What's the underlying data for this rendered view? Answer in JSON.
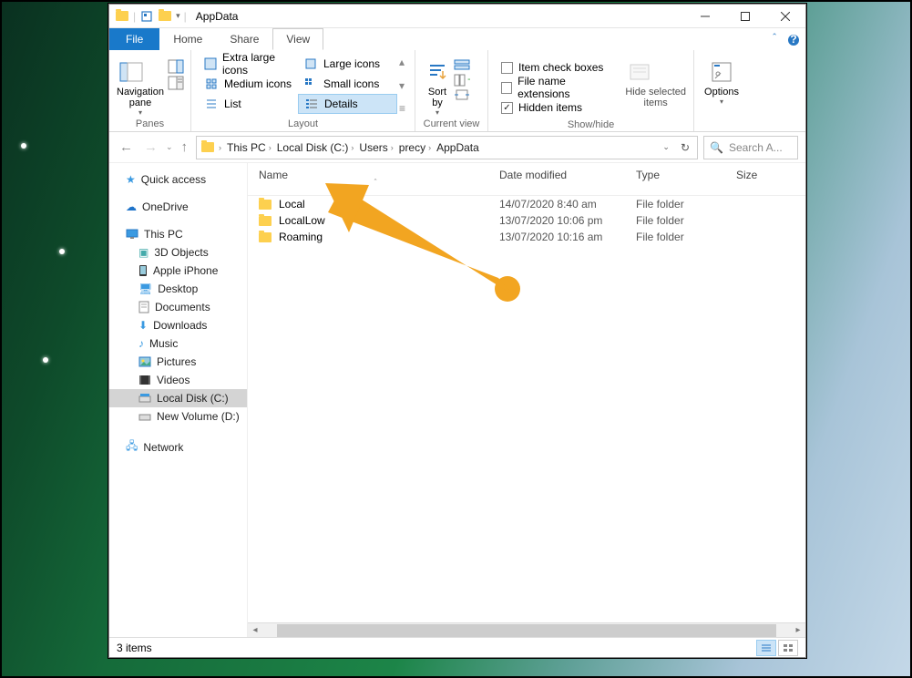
{
  "window": {
    "title": "AppData",
    "min_tooltip": "Minimize",
    "max_tooltip": "Maximize",
    "close_tooltip": "Close"
  },
  "tabs": {
    "file": "File",
    "home": "Home",
    "share": "Share",
    "view": "View"
  },
  "ribbon": {
    "panes_group": "Panes",
    "navigation_pane": "Navigation\npane",
    "layout_group": "Layout",
    "extra_large": "Extra large icons",
    "large": "Large icons",
    "medium": "Medium icons",
    "small": "Small icons",
    "list": "List",
    "details": "Details",
    "current_view_group": "Current view",
    "sort_by": "Sort\nby",
    "show_hide_group": "Show/hide",
    "item_check": "Item check boxes",
    "file_ext": "File name extensions",
    "hidden": "Hidden items",
    "hide_selected": "Hide selected\nitems",
    "options": "Options"
  },
  "breadcrumb": {
    "items": [
      "This PC",
      "Local Disk (C:)",
      "Users",
      "precy",
      "AppData"
    ]
  },
  "search": {
    "placeholder": "Search A..."
  },
  "refresh": "Refresh",
  "nav": {
    "quick": "Quick access",
    "onedrive": "OneDrive",
    "thispc": "This PC",
    "obj3d": "3D Objects",
    "iphone": "Apple iPhone",
    "desktop": "Desktop",
    "documents": "Documents",
    "downloads": "Downloads",
    "music": "Music",
    "pictures": "Pictures",
    "videos": "Videos",
    "localdisk": "Local Disk (C:)",
    "newvol": "New Volume (D:)",
    "network": "Network"
  },
  "columns": {
    "name": "Name",
    "date": "Date modified",
    "type": "Type",
    "size": "Size"
  },
  "files": [
    {
      "name": "Local",
      "date": "14/07/2020 8:40 am",
      "type": "File folder"
    },
    {
      "name": "LocalLow",
      "date": "13/07/2020 10:06 pm",
      "type": "File folder"
    },
    {
      "name": "Roaming",
      "date": "13/07/2020 10:16 am",
      "type": "File folder"
    }
  ],
  "status": {
    "count": "3 items"
  }
}
